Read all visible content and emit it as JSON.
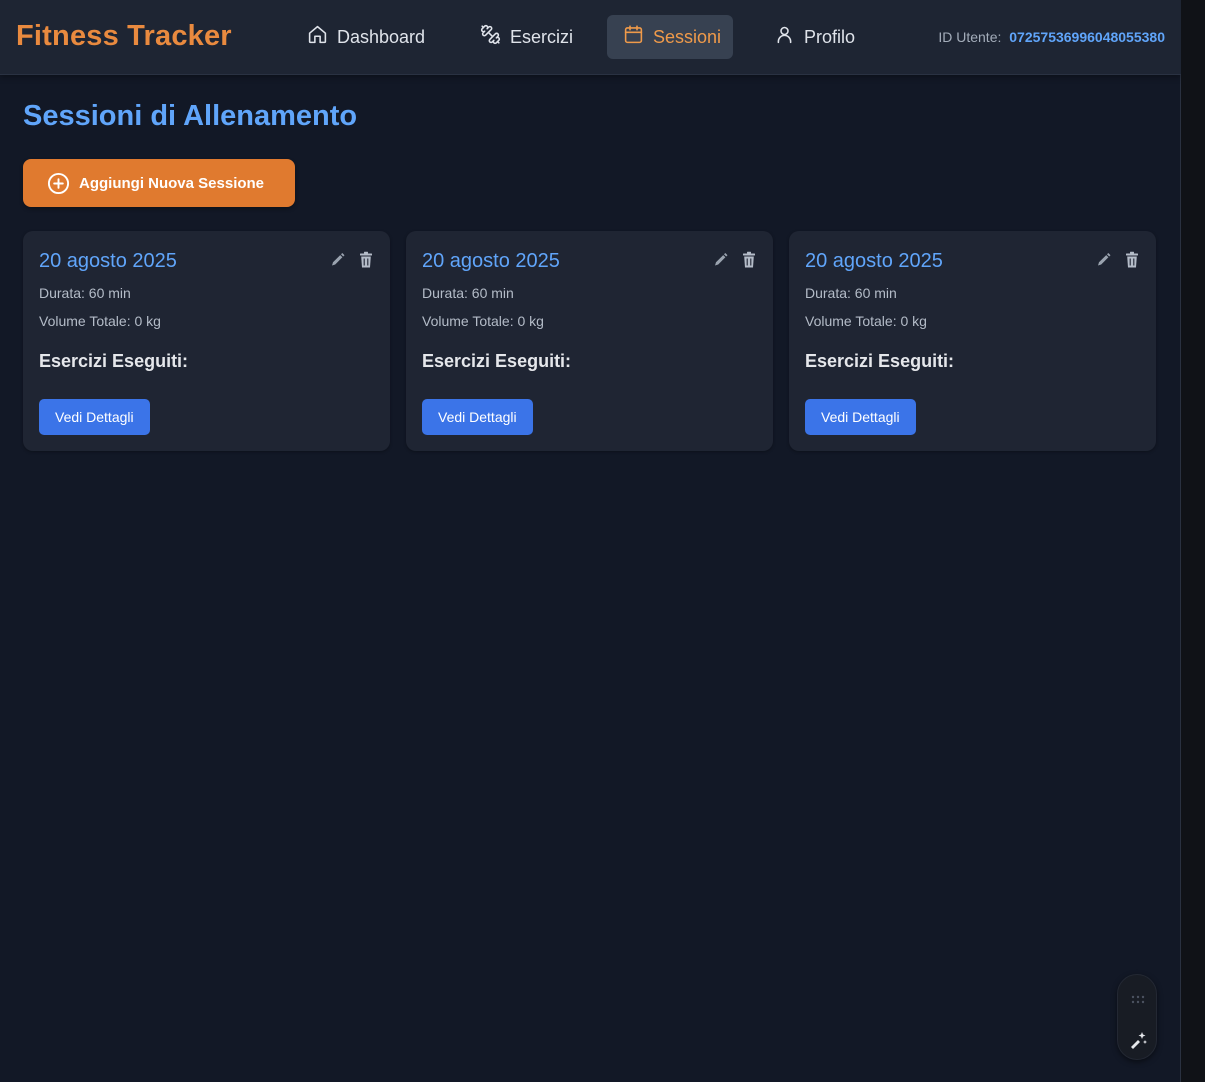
{
  "app": {
    "title": "Fitness Tracker"
  },
  "nav": {
    "items": [
      {
        "label": "Dashboard",
        "icon": "home-icon"
      },
      {
        "label": "Esercizi",
        "icon": "dumbbell-icon"
      },
      {
        "label": "Sessioni",
        "icon": "calendar-icon",
        "active": true
      },
      {
        "label": "Profilo",
        "icon": "user-icon"
      }
    ]
  },
  "user": {
    "id_label": "ID Utente:",
    "id_value": "07257536996048055380"
  },
  "page": {
    "title": "Sessioni di Allenamento",
    "add_button_label": "Aggiungi Nuova Sessione"
  },
  "sessions": [
    {
      "date": "20 agosto 2025",
      "duration": "Durata: 60 min",
      "volume": "Volume Totale: 0 kg",
      "exercises_heading": "Esercizi Eseguiti:",
      "details_label": "Vedi Dettagli"
    },
    {
      "date": "20 agosto 2025",
      "duration": "Durata: 60 min",
      "volume": "Volume Totale: 0 kg",
      "exercises_heading": "Esercizi Eseguiti:",
      "details_label": "Vedi Dettagli"
    },
    {
      "date": "20 agosto 2025",
      "duration": "Durata: 60 min",
      "volume": "Volume Totale: 0 kg",
      "exercises_heading": "Esercizi Eseguiti:",
      "details_label": "Vedi Dettagli"
    }
  ],
  "colors": {
    "brand": "#e98a3f",
    "accent": "#60a5fa",
    "primary_button": "#3b74e8",
    "add_button": "#e07a2f",
    "background": "#121826",
    "card": "#1f2533"
  }
}
